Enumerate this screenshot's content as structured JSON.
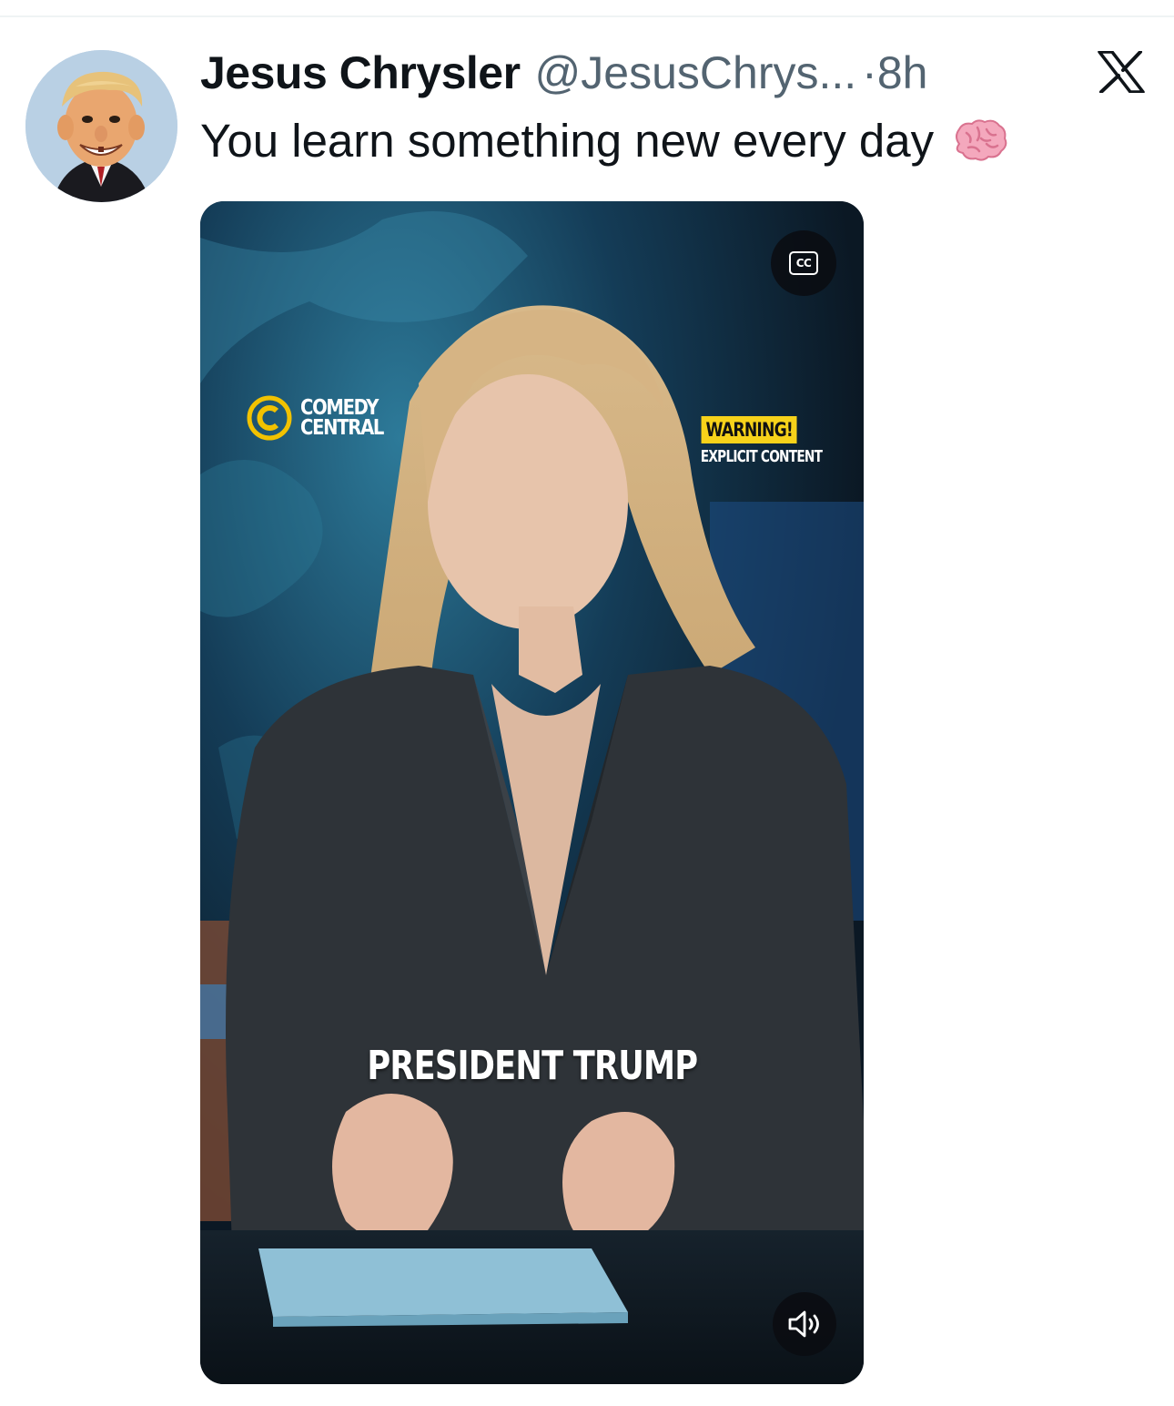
{
  "tweet": {
    "display_name": "Jesus Chrysler",
    "handle": "@JesusChrys...",
    "separator": "·",
    "timestamp": "8h",
    "text": "You learn something new every day",
    "emoji": "brain-emoji",
    "platform_icon": "x-logo-icon"
  },
  "video": {
    "network_logo_line1": "COMEDY",
    "network_logo_line2": "CENTRAL",
    "warning_badge": "WARNING!",
    "warning_subtext": "EXPLICIT CONTENT",
    "caption": "PRESIDENT TRUMP",
    "cc_label": "CC",
    "controls": [
      "closed-captions-icon",
      "volume-icon"
    ]
  },
  "colors": {
    "text_primary": "#0f1419",
    "text_secondary": "#536471",
    "warning_yellow": "#f7d21a",
    "logo_yellow": "#f2c200"
  }
}
